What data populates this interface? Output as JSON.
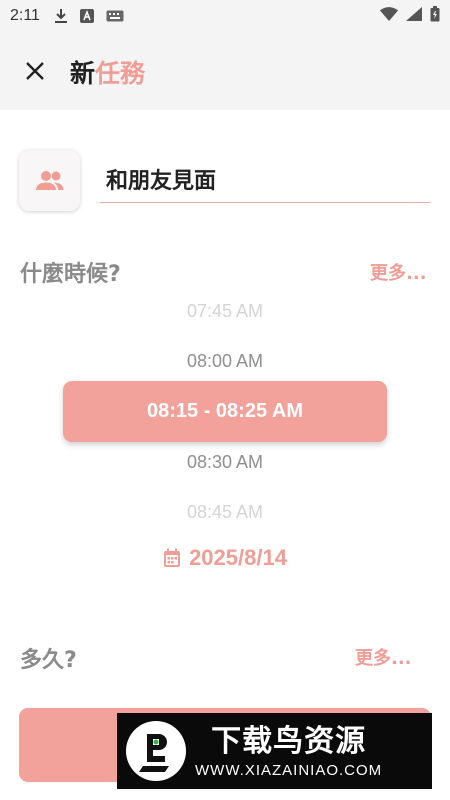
{
  "status_bar": {
    "time": "2:11",
    "left_icons": [
      "download-icon",
      "a-app-icon",
      "keyboard-icon"
    ],
    "right_icons": [
      "wifi-icon",
      "signal-icon",
      "battery-icon"
    ]
  },
  "app_bar": {
    "title_part1": "新",
    "title_part2": "任務",
    "close_icon": "close-icon"
  },
  "task": {
    "icon": "people-icon",
    "name_value": "和朋友見面"
  },
  "when": {
    "label": "什麼時候?",
    "more": "更多...",
    "times": [
      "07:45 AM",
      "08:00 AM",
      "08:30 AM",
      "08:45 AM"
    ],
    "selected": "08:15 - 08:25 AM",
    "date": "2025/8/14"
  },
  "duration": {
    "label": "多久?",
    "more": "更多..."
  },
  "watermark": {
    "main": "下载鸟资源",
    "url": "WWW.XIAZAINIAO.COM"
  },
  "colors": {
    "accent": "#f2a19b",
    "accent_text": "#f09d96",
    "header_bg": "#f4f4f4"
  }
}
